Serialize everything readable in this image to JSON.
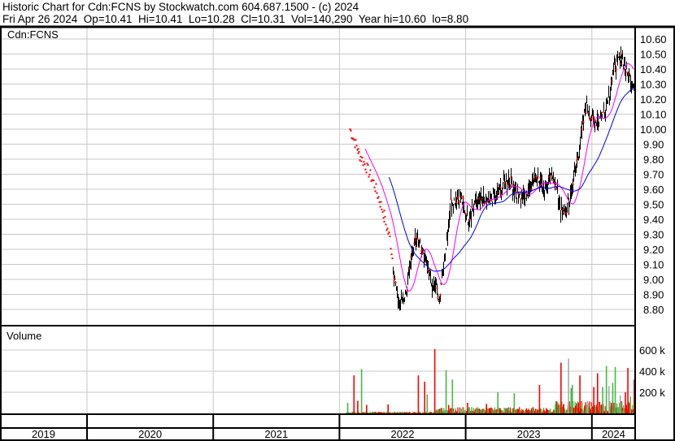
{
  "header": {
    "title": "Historic Chart for Cdn:FCNS by Stockwatch.com 604.687.1500 - (c) 2024",
    "quote": "Fri Apr 26 2024  Op=10.41  Hi=10.41  Lo=10.28  Cl=10.31  Vol=140,290  Year hi=10.60  lo=8.80"
  },
  "chart_data": [
    {
      "type": "line",
      "title": "Cdn:FCNS",
      "ylim": [
        8.75,
        10.65
      ],
      "yticks": [
        "10.60",
        "10.50",
        "10.40",
        "10.30",
        "10.20",
        "10.10",
        "10.00",
        "9.90",
        "9.80",
        "9.70",
        "9.60",
        "9.50",
        "9.40",
        "9.30",
        "9.20",
        "9.10",
        "9.00",
        "8.90",
        "8.80"
      ],
      "xlabel_years": [
        "2019",
        "2020",
        "2021",
        "2022",
        "2023",
        "2024"
      ],
      "series": [
        {
          "name": "Price",
          "x": [
            2022.08,
            2022.14,
            2022.21,
            2022.27,
            2022.34,
            2022.4,
            2022.45,
            2022.48,
            2022.53,
            2022.6,
            2022.66,
            2022.72,
            2022.79,
            2022.82,
            2022.88,
            2022.95,
            2023.02,
            2023.08,
            2023.18,
            2023.27,
            2023.34,
            2023.4,
            2023.47,
            2023.56,
            2023.63,
            2023.69,
            2023.76,
            2023.82,
            2023.89,
            2023.95,
            2024.01,
            2024.08,
            2024.14,
            2024.18,
            2024.24,
            2024.28,
            2024.33
          ],
          "y": [
            10.0,
            9.86,
            9.75,
            9.64,
            9.45,
            9.27,
            8.91,
            8.83,
            8.94,
            9.29,
            9.18,
            9.0,
            8.89,
            9.05,
            9.51,
            9.56,
            9.4,
            9.53,
            9.51,
            9.59,
            9.67,
            9.56,
            9.56,
            9.7,
            9.59,
            9.7,
            9.43,
            9.51,
            9.83,
            10.16,
            10.05,
            10.08,
            10.26,
            10.43,
            10.48,
            10.37,
            10.3
          ]
        },
        {
          "name": "Short moving average",
          "color": "#ff00ff"
        },
        {
          "name": "Long moving average",
          "color": "#0000ff"
        }
      ]
    },
    {
      "type": "bar",
      "title": "Volume",
      "yticks": [
        "600 k",
        "400 k",
        "200 k"
      ],
      "ylim": [
        0,
        800000
      ],
      "series": [
        {
          "name": "Volume",
          "x": [
            2022.06,
            2022.11,
            2022.14,
            2022.17,
            2022.21,
            2022.38,
            2022.62,
            2022.67,
            2022.69,
            2022.75,
            2022.84,
            2022.86,
            2022.89,
            2023.01,
            2023.16,
            2023.25,
            2023.38,
            2023.58,
            2023.75,
            2023.81,
            2023.83,
            2023.84,
            2023.9,
            2023.96,
            2024.01,
            2024.04,
            2024.08,
            2024.11,
            2024.13,
            2024.16,
            2024.18,
            2024.22,
            2024.26,
            2024.28,
            2024.3,
            2024.33
          ],
          "y": [
            100000,
            360000,
            120000,
            420000,
            80000,
            85000,
            360000,
            300000,
            180000,
            610000,
            410000,
            80000,
            320000,
            100000,
            90000,
            200000,
            190000,
            270000,
            480000,
            520000,
            240000,
            270000,
            360000,
            120000,
            250000,
            380000,
            250000,
            450000,
            260000,
            290000,
            440000,
            170000,
            200000,
            430000,
            160000,
            320000
          ],
          "color": [
            "g",
            "r",
            "r",
            "g",
            "r",
            "r",
            "r",
            "r",
            "g",
            "r",
            "g",
            "r",
            "g",
            "r",
            "r",
            "g",
            "g",
            "r",
            "r",
            "gray",
            "g",
            "g",
            "r",
            "gray",
            "r",
            "r",
            "g",
            "g",
            "gray",
            "g",
            "g",
            "gray",
            "r",
            "r",
            "g",
            "r"
          ]
        }
      ],
      "colors": {
        "up": "#44bb44",
        "down": "#ff0000",
        "flat": "#aaaaaa"
      }
    }
  ]
}
